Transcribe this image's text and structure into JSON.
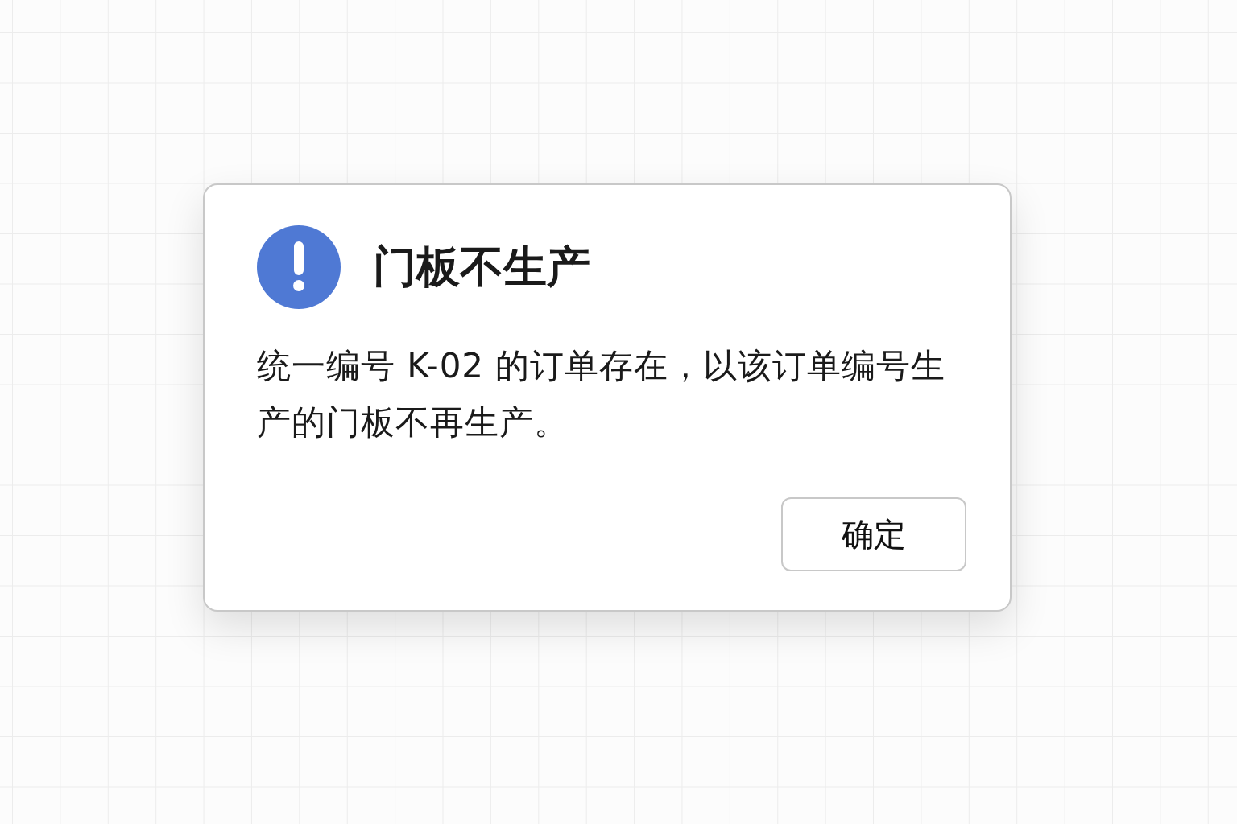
{
  "dialog": {
    "title": "门板不生产",
    "message": "统一编号 K-02 的订单存在，以该订单编号生产的门板不再生产。",
    "buttons": [
      {
        "label": "确定"
      }
    ]
  }
}
